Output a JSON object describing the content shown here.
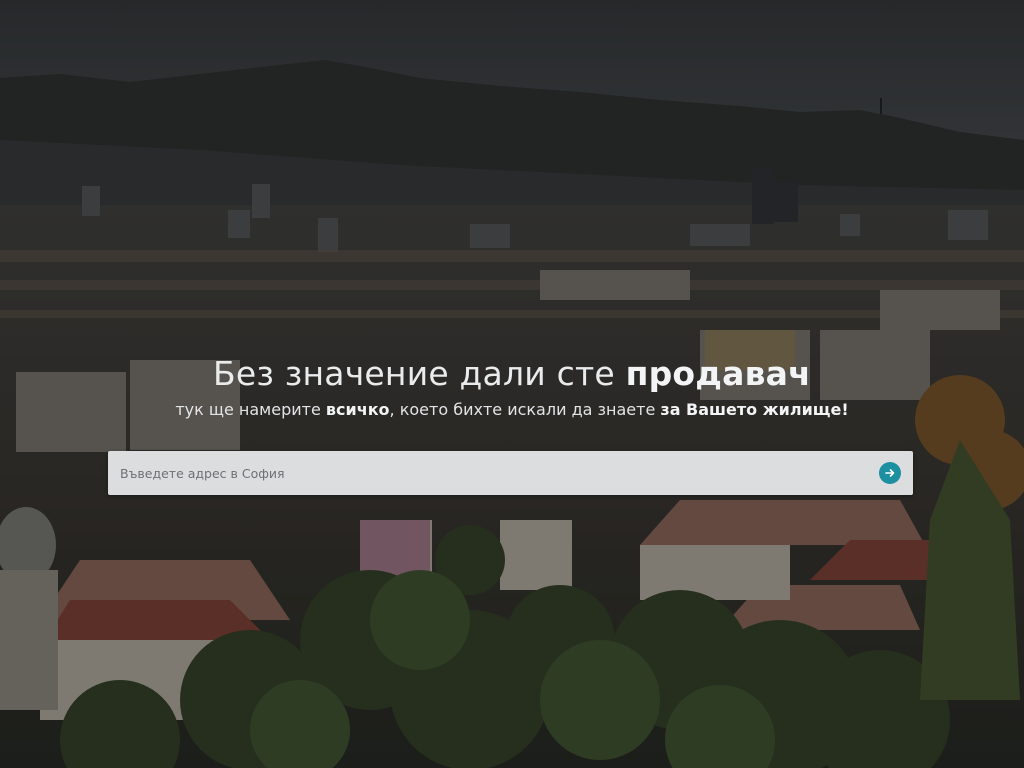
{
  "hero": {
    "headline_part1": "Без значение дали сте ",
    "headline_bold": "продавач",
    "subline_part1": "тук ще намерите ",
    "subline_bold1": "всичко",
    "subline_part2": ", което бихте искали да знаете ",
    "subline_bold2": "за Вашето жилище!"
  },
  "search": {
    "placeholder": "Въведете адрес в София",
    "value": "",
    "submit_icon": "arrow-right-icon"
  },
  "colors": {
    "accent": "#1c8fa0",
    "input_background": "#dcdddf",
    "sky": "#3a3d40"
  }
}
